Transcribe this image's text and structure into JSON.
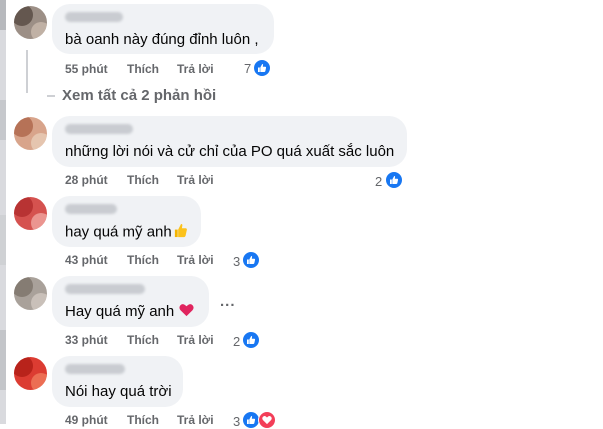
{
  "theme": {
    "bubble_bg": "#f0f2f5",
    "meta_color": "#65676b",
    "like_blue": "#1877f2",
    "love_red": "#f33e58"
  },
  "actions": {
    "like": "Thích",
    "reply": "Trả lời"
  },
  "view_replies": "Xem tất cả 2 phản hồi",
  "comments": [
    {
      "text": "bà oanh này đúng đỉnh luôn ,",
      "time": "55 phút",
      "reactions": "7",
      "reaction_icons": [
        "like-icon"
      ]
    },
    {
      "text": "những lời nói và cử chỉ của PO quá xuất sắc luôn",
      "time": "28 phút",
      "reactions": "2",
      "reaction_icons": [
        "like-icon"
      ]
    },
    {
      "text": "hay quá mỹ anh",
      "emoji": "thumbs-up-emoji",
      "time": "43 phút",
      "reactions": "3",
      "reaction_icons": [
        "like-icon"
      ]
    },
    {
      "text": "Hay quá mỹ anh",
      "emoji": "red-heart-emoji",
      "more": "...",
      "time": "33 phút",
      "reactions": "2",
      "reaction_icons": [
        "like-icon"
      ]
    },
    {
      "text": "Nói hay quá trời",
      "time": "49 phút",
      "reactions": "3",
      "reaction_icons": [
        "like-icon",
        "heart-icon"
      ]
    }
  ]
}
